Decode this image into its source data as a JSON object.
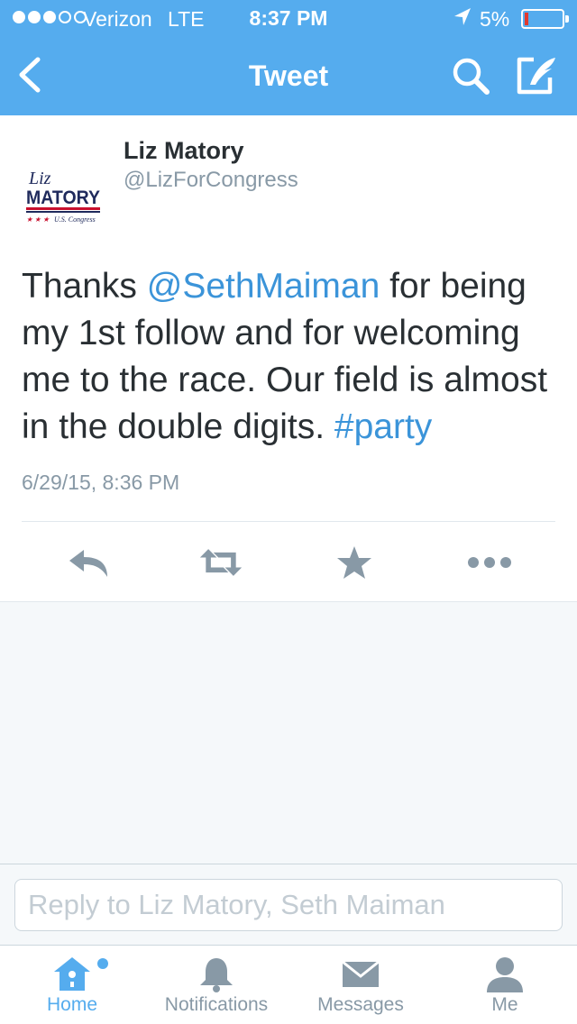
{
  "status_bar": {
    "carrier": "Verizon",
    "network": "LTE",
    "time": "8:37 PM",
    "battery": "5%",
    "battery_level": 0.05,
    "signal_bars": 3,
    "signal_total": 5
  },
  "nav": {
    "title": "Tweet",
    "back_icon": "chevron-left-icon",
    "search_icon": "search-icon",
    "compose_icon": "compose-icon"
  },
  "tweet": {
    "author_name": "Liz Matory",
    "author_handle": "@LizForCongress",
    "avatar_logo": {
      "line1": "Liz",
      "line2": "MATORY",
      "line3": "★ ★ ★ U.S. Congress"
    },
    "text_parts": {
      "p1": "Thanks ",
      "mention": "@SethMaiman",
      "p2": " for being my 1st follow and for welcoming me to the race. Our field is almost in the double digits. ",
      "hashtag": "#party"
    },
    "timestamp": "6/29/15, 8:36 PM",
    "actions": [
      "reply-icon",
      "retweet-icon",
      "favorite-icon",
      "more-icon"
    ]
  },
  "reply": {
    "placeholder": "Reply to Liz Matory, Seth Maiman"
  },
  "tabs": [
    {
      "label": "Home",
      "icon": "home-icon",
      "active": true
    },
    {
      "label": "Notifications",
      "icon": "bell-icon",
      "active": false
    },
    {
      "label": "Messages",
      "icon": "envelope-icon",
      "active": false
    },
    {
      "label": "Me",
      "icon": "person-icon",
      "active": false
    }
  ],
  "colors": {
    "brand": "#55acee",
    "link": "#3b94d9",
    "text": "#292f33",
    "muted": "#8899a6",
    "battery_low": "#e03a2f",
    "logo_navy": "#1f2a5c",
    "logo_red": "#c8102e"
  }
}
